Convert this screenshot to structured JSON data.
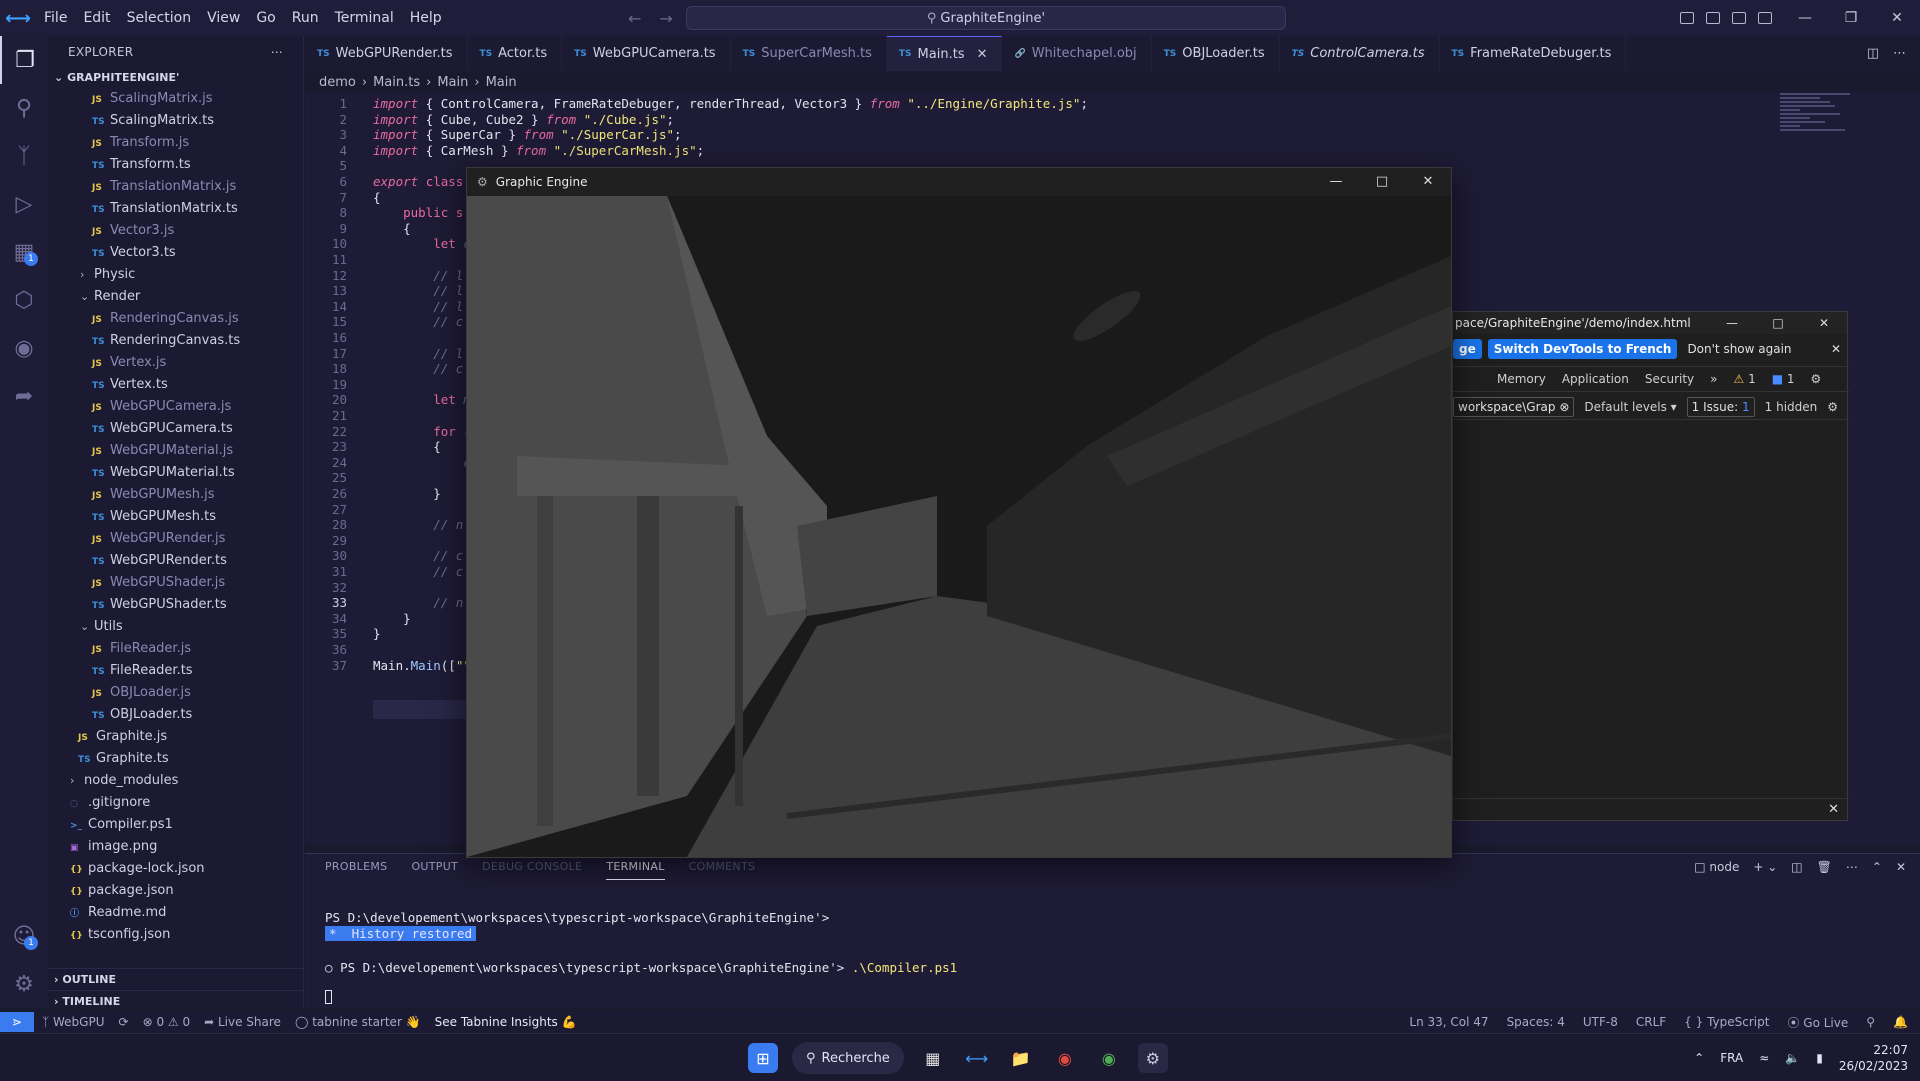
{
  "menu": [
    "File",
    "Edit",
    "Selection",
    "View",
    "Go",
    "Run",
    "Terminal",
    "Help"
  ],
  "command_center": "GraphiteEngine'",
  "explorer": {
    "title": "EXPLORER",
    "root": "GRAPHITEENGINE'",
    "items": [
      {
        "label": "ScalingMatrix.js",
        "kind": "js"
      },
      {
        "label": "ScalingMatrix.ts",
        "kind": "ts"
      },
      {
        "label": "Transform.js",
        "kind": "js"
      },
      {
        "label": "Transform.ts",
        "kind": "ts"
      },
      {
        "label": "TranslationMatrix.js",
        "kind": "js"
      },
      {
        "label": "TranslationMatrix.ts",
        "kind": "ts"
      },
      {
        "label": "Vector3.js",
        "kind": "js"
      },
      {
        "label": "Vector3.ts",
        "kind": "ts"
      },
      {
        "label": "Physic",
        "kind": "folder"
      },
      {
        "label": "Render",
        "kind": "folder-open"
      },
      {
        "label": "RenderingCanvas.js",
        "kind": "js"
      },
      {
        "label": "RenderingCanvas.ts",
        "kind": "ts"
      },
      {
        "label": "Vertex.js",
        "kind": "js"
      },
      {
        "label": "Vertex.ts",
        "kind": "ts"
      },
      {
        "label": "WebGPUCamera.js",
        "kind": "js"
      },
      {
        "label": "WebGPUCamera.ts",
        "kind": "ts"
      },
      {
        "label": "WebGPUMaterial.js",
        "kind": "js"
      },
      {
        "label": "WebGPUMaterial.ts",
        "kind": "ts"
      },
      {
        "label": "WebGPUMesh.js",
        "kind": "js"
      },
      {
        "label": "WebGPUMesh.ts",
        "kind": "ts"
      },
      {
        "label": "WebGPURender.js",
        "kind": "js"
      },
      {
        "label": "WebGPURender.ts",
        "kind": "ts"
      },
      {
        "label": "WebGPUShader.js",
        "kind": "js"
      },
      {
        "label": "WebGPUShader.ts",
        "kind": "ts"
      },
      {
        "label": "Utils",
        "kind": "folder-open"
      },
      {
        "label": "FileReader.js",
        "kind": "js"
      },
      {
        "label": "FileReader.ts",
        "kind": "ts"
      },
      {
        "label": "OBJLoader.js",
        "kind": "js"
      },
      {
        "label": "OBJLoader.ts",
        "kind": "ts"
      },
      {
        "label": "Graphite.js",
        "kind": "js"
      },
      {
        "label": "Graphite.ts",
        "kind": "ts"
      },
      {
        "label": "node_modules",
        "kind": "folder"
      },
      {
        "label": ".gitignore",
        "kind": "git"
      },
      {
        "label": "Compiler.ps1",
        "kind": "ps"
      },
      {
        "label": "image.png",
        "kind": "png"
      },
      {
        "label": "package-lock.json",
        "kind": "json"
      },
      {
        "label": "package.json",
        "kind": "json"
      },
      {
        "label": "Readme.md",
        "kind": "md"
      },
      {
        "label": "tsconfig.json",
        "kind": "json"
      }
    ],
    "outline": "OUTLINE",
    "timeline": "TIMELINE"
  },
  "tabs": [
    {
      "label": "WebGPURender.ts",
      "style": "normal"
    },
    {
      "label": "Actor.ts",
      "style": "normal"
    },
    {
      "label": "WebGPUCamera.ts",
      "style": "normal"
    },
    {
      "label": "SuperCarMesh.ts",
      "style": "dim"
    },
    {
      "label": "Main.ts",
      "style": "active"
    },
    {
      "label": "Whitechapel.obj",
      "style": "dim"
    },
    {
      "label": "OBJLoader.ts",
      "style": "normal"
    },
    {
      "label": "ControlCamera.ts",
      "style": "italic"
    },
    {
      "label": "FrameRateDebuger.ts",
      "style": "normal"
    }
  ],
  "breadcrumb": [
    "demo",
    "Main.ts",
    "Main",
    "Main"
  ],
  "code_lines": [
    {
      "n": "1",
      "html": "<span class='kw'>import</span> { ControlCamera, FrameRateDebuger, renderThread, Vector3 } <span class='kw'>from</span> <span class='str'>\"../Engine/Graphite.js\"</span>;"
    },
    {
      "n": "2",
      "html": "<span class='kw'>import</span> { Cube, Cube2 } <span class='kw'>from</span> <span class='str'>\"./Cube.js\"</span>;"
    },
    {
      "n": "3",
      "html": "<span class='kw'>import</span> { SuperCar } <span class='kw'>from</span> <span class='str'>\"./SuperCar.js\"</span>;"
    },
    {
      "n": "4",
      "html": "<span class='kw'>import</span> { CarMesh } <span class='kw'>from</span> <span class='str'>\"./SuperCarMesh.js\"</span>;"
    },
    {
      "n": "5",
      "html": ""
    },
    {
      "n": "6",
      "html": "<span class='kw'>export</span> <span class='kw2'>class</span>"
    },
    {
      "n": "7",
      "html": "{"
    },
    {
      "n": "8",
      "html": "    <span class='kw2'>public</span> <span class='kw2'>s</span>"
    },
    {
      "n": "9",
      "html": "    {"
    },
    {
      "n": "10",
      "html": "        <span class='kw2'>let</span> <span class='cm'>c</span>"
    },
    {
      "n": "11",
      "html": ""
    },
    {
      "n": "12",
      "html": "        <span class='cm'>// l</span>"
    },
    {
      "n": "13",
      "html": "        <span class='cm'>// l</span>"
    },
    {
      "n": "14",
      "html": "        <span class='cm'>// l</span>"
    },
    {
      "n": "15",
      "html": "        <span class='cm'>// c</span>"
    },
    {
      "n": "16",
      "html": ""
    },
    {
      "n": "17",
      "html": "        <span class='cm'>// l</span>"
    },
    {
      "n": "18",
      "html": "        <span class='cm'>// c</span>"
    },
    {
      "n": "19",
      "html": ""
    },
    {
      "n": "20",
      "html": "        <span class='kw2'>let</span> <span class='cm'>m</span>"
    },
    {
      "n": "21",
      "html": ""
    },
    {
      "n": "22",
      "html": "        <span class='kw2'>for</span> <span class='cm'>(</span>"
    },
    {
      "n": "23",
      "html": "        {"
    },
    {
      "n": "24",
      "html": "            <span class='cm'>c</span>"
    },
    {
      "n": "25",
      "html": ""
    },
    {
      "n": "26",
      "html": "        }"
    },
    {
      "n": "27",
      "html": ""
    },
    {
      "n": "28",
      "html": "        <span class='cm'>// n</span>"
    },
    {
      "n": "29",
      "html": ""
    },
    {
      "n": "30",
      "html": "        <span class='cm'>// c</span>"
    },
    {
      "n": "31",
      "html": "        <span class='cm'>// c</span>"
    },
    {
      "n": "32",
      "html": ""
    },
    {
      "n": "33",
      "html": "        <span class='cm'>// n</span>"
    },
    {
      "n": "34",
      "html": "    }"
    },
    {
      "n": "35",
      "html": "}"
    },
    {
      "n": "36",
      "html": ""
    },
    {
      "n": "37",
      "html": "Main.<span class='cls'>Main</span>([<span class='str'>\"\"</span>"
    }
  ],
  "current_line": "33",
  "panel": {
    "tabs": [
      {
        "label": "PROBLEMS",
        "style": "normal"
      },
      {
        "label": "OUTPUT",
        "style": "normal"
      },
      {
        "label": "DEBUG CONSOLE",
        "style": "faded"
      },
      {
        "label": "TERMINAL",
        "style": "active"
      },
      {
        "label": "COMMENTS",
        "style": "faded"
      }
    ],
    "shell": "node",
    "terminal": {
      "line1": "PS D:\\developement\\workspaces\\typescript-workspace\\GraphiteEngine'>",
      "history": "*  History restored",
      "line2_prompt": "PS D:\\developement\\workspaces\\typescript-workspace\\GraphiteEngine'>",
      "line2_cmd": ".\\Compiler.ps1"
    }
  },
  "status": {
    "webgpu": "WebGPU",
    "errors": "0",
    "warnings": "0",
    "live_share": "Live Share",
    "tabnine": "tabnine starter",
    "insights": "See Tabnine Insights",
    "position": "Ln 33, Col 47",
    "spaces": "Spaces: 4",
    "encoding": "UTF-8",
    "eol": "CRLF",
    "language": "TypeScript",
    "go_live": "Go Live"
  },
  "graphic_engine": {
    "title": "Graphic Engine"
  },
  "devtools": {
    "title": "pace/GraphiteEngine'/demo/index.html",
    "info_left": "ge",
    "switch_button": "Switch DevTools to French",
    "dont_show": "Don't show again",
    "tabs": [
      "Memory",
      "Application",
      "Security"
    ],
    "warn_count": "1",
    "msg_count": "1",
    "filter_value": "workspace\\Grap",
    "levels": "Default levels",
    "issues": "1 Issue:",
    "issue_count": "1",
    "hidden": "1 hidden"
  },
  "taskbar": {
    "search": "Recherche",
    "lang": "FRA",
    "time": "22:07",
    "date": "26/02/2023"
  }
}
